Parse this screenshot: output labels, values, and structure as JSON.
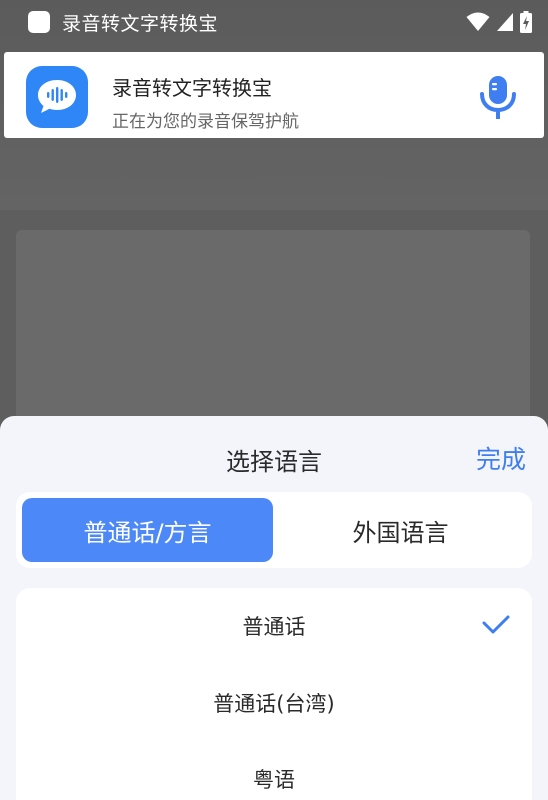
{
  "status_bar": {
    "app_title": "录音转文字转换宝",
    "icons": [
      "wifi-icon",
      "signal-icon",
      "battery-icon"
    ]
  },
  "notification": {
    "app_icon": "voice-wave-icon",
    "title": "录音转文字转换宝",
    "subtitle": "正在为您的录音保驾护航",
    "action_icon": "microphone-icon"
  },
  "sheet": {
    "title": "选择语言",
    "done_label": "完成",
    "tabs": [
      {
        "label": "普通话/方言",
        "active": true
      },
      {
        "label": "外国语言",
        "active": false
      }
    ],
    "languages": [
      {
        "label": "普通话",
        "selected": true
      },
      {
        "label": "普通话(台湾)",
        "selected": false
      },
      {
        "label": "粤语",
        "selected": false
      }
    ]
  },
  "colors": {
    "accent": "#4c88f7",
    "done": "#3f7ef0",
    "check": "#3f7ef0",
    "icon_bg": "#2f86f6"
  }
}
